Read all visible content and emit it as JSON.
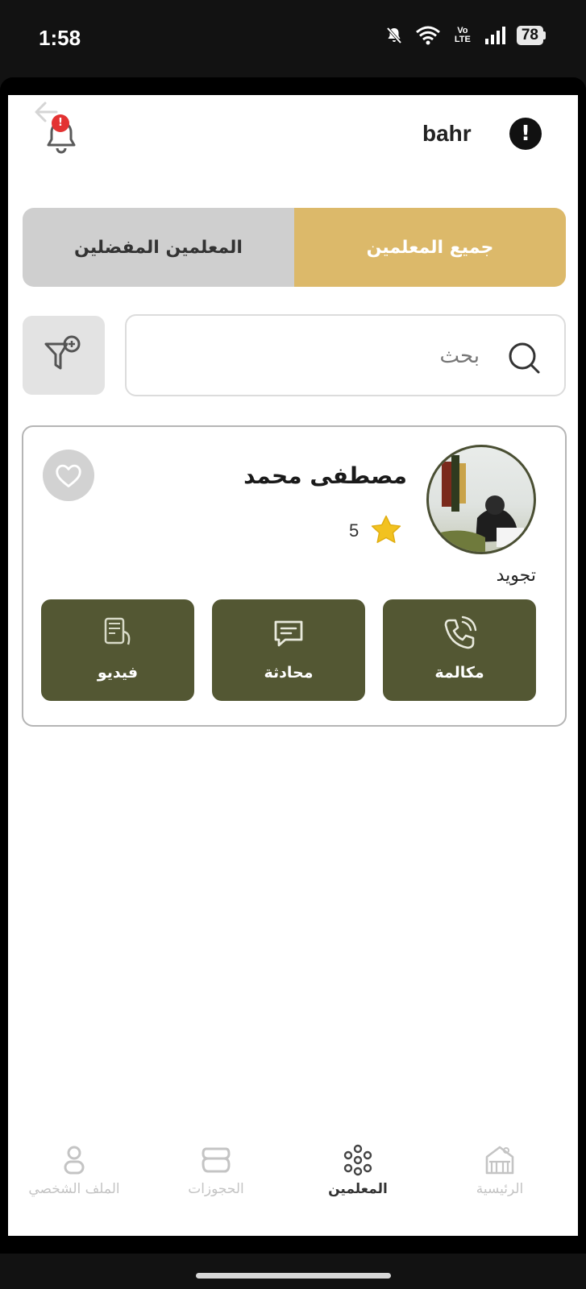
{
  "status_bar": {
    "time": "1:58",
    "network_label": "Vo LTE",
    "battery": "78"
  },
  "header": {
    "username": "bahr",
    "notification_badge": "!",
    "info_symbol": "!"
  },
  "tabs": {
    "favorites_label": "المعلمين المفضلين",
    "all_label": "جميع المعلمين",
    "active": "all"
  },
  "search": {
    "placeholder": "بحث"
  },
  "teacher": {
    "name": "مصطفى محمد",
    "rating": "5",
    "subject": "تجويد",
    "actions": {
      "call_label": "مكالمة",
      "chat_label": "محادثة",
      "video_label": "فيديو"
    }
  },
  "bottom_nav": {
    "home_label": "الرئيسية",
    "teachers_label": "المعلمين",
    "bookings_label": "الحجوزات",
    "profile_label": "الملف الشخصي",
    "active": "teachers"
  },
  "colors": {
    "accent_gold": "#dcb96a",
    "action_olive": "#535733",
    "star": "#f2c220",
    "badge_red": "#e33232"
  },
  "icons": [
    "back-arrow-icon",
    "bell-icon",
    "info-icon",
    "filter-icon",
    "search-icon",
    "heart-icon",
    "star-icon",
    "phone-icon",
    "chat-icon",
    "video-icon",
    "home-icon",
    "teachers-icon",
    "bookings-icon",
    "profile-icon"
  ]
}
